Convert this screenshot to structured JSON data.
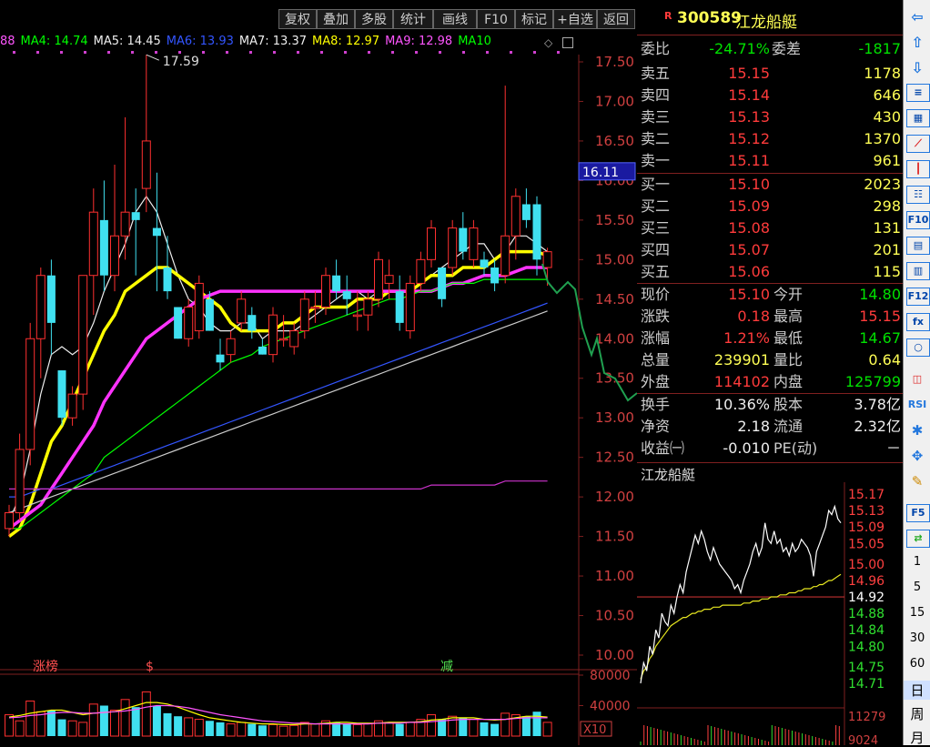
{
  "toolbar": {
    "buttons": [
      "复权",
      "叠加",
      "多股",
      "统计",
      "画线",
      "F10",
      "标记",
      "+自选",
      "返回"
    ]
  },
  "ma_bar": [
    {
      "label": "88",
      "color": "#ff55ff"
    },
    {
      "label": "MA4: 14.74",
      "color": "#00ff00"
    },
    {
      "label": "MA5: 14.45",
      "color": "#eeeeee"
    },
    {
      "label": "MA6: 13.93",
      "color": "#3355ff"
    },
    {
      "label": "MA7: 13.37",
      "color": "#eeeeee"
    },
    {
      "label": "MA8: 12.97",
      "color": "#ffff00"
    },
    {
      "label": "MA9: 12.98",
      "color": "#ff55ff"
    },
    {
      "label": "MA10",
      "color": "#00ff00"
    }
  ],
  "chart": {
    "high_label": "17.59",
    "price_tag": "16.11",
    "y_ticks": [
      "17.50",
      "17.00",
      "16.50",
      "16.00",
      "15.50",
      "15.00",
      "14.50",
      "14.00",
      "13.50",
      "13.00",
      "12.50",
      "12.00",
      "11.50",
      "11.00",
      "10.50",
      "10.00"
    ],
    "vol_ticks": [
      "80000",
      "40000"
    ],
    "vol_unit": "X10",
    "markers": [
      "涨榜",
      "$",
      "减"
    ]
  },
  "chart_data": {
    "type": "candlestick",
    "candles": [
      [
        11.6,
        11.9,
        11.5,
        11.8
      ],
      [
        11.8,
        12.8,
        11.7,
        12.6
      ],
      [
        12.6,
        14.2,
        12.4,
        14.0
      ],
      [
        14.0,
        14.9,
        13.5,
        14.8
      ],
      [
        14.8,
        15.0,
        13.8,
        14.2
      ],
      [
        13.6,
        13.6,
        12.9,
        13.0
      ],
      [
        13.0,
        13.4,
        12.9,
        13.3
      ],
      [
        13.3,
        14.8,
        13.1,
        14.8
      ],
      [
        14.8,
        15.9,
        14.3,
        15.6
      ],
      [
        15.5,
        16.0,
        14.6,
        14.8
      ],
      [
        14.8,
        16.2,
        14.6,
        15.3
      ],
      [
        15.3,
        16.8,
        15.0,
        15.6
      ],
      [
        15.6,
        15.9,
        14.8,
        15.5
      ],
      [
        15.9,
        17.59,
        15.6,
        16.5
      ],
      [
        15.4,
        16.1,
        14.6,
        15.3
      ],
      [
        14.9,
        15.3,
        14.5,
        14.6
      ],
      [
        14.4,
        14.4,
        14.0,
        14.0
      ],
      [
        14.0,
        14.5,
        13.9,
        14.4
      ],
      [
        14.1,
        14.8,
        14.0,
        14.7
      ],
      [
        14.5,
        14.6,
        14.1,
        14.1
      ],
      [
        13.8,
        14.0,
        13.6,
        13.7
      ],
      [
        13.8,
        14.1,
        13.7,
        14.0
      ],
      [
        14.2,
        14.6,
        14.1,
        14.5
      ],
      [
        14.3,
        14.4,
        14.0,
        14.1
      ],
      [
        13.9,
        14.0,
        13.8,
        13.8
      ],
      [
        13.8,
        14.4,
        13.7,
        14.3
      ],
      [
        14.0,
        14.3,
        13.9,
        14.0
      ],
      [
        13.9,
        14.2,
        13.8,
        14.1
      ],
      [
        14.1,
        14.6,
        14.0,
        14.5
      ],
      [
        14.4,
        14.6,
        14.2,
        14.4
      ],
      [
        14.4,
        14.9,
        14.3,
        14.8
      ],
      [
        14.8,
        15.0,
        14.5,
        14.6
      ],
      [
        14.6,
        14.8,
        14.3,
        14.5
      ],
      [
        14.3,
        14.6,
        14.1,
        14.3
      ],
      [
        14.3,
        14.6,
        14.1,
        14.5
      ],
      [
        14.5,
        15.1,
        14.4,
        15.0
      ],
      [
        14.7,
        15.0,
        14.5,
        14.8
      ],
      [
        14.6,
        14.8,
        14.1,
        14.2
      ],
      [
        14.1,
        14.8,
        14.0,
        14.7
      ],
      [
        14.7,
        15.1,
        14.6,
        15.0
      ],
      [
        15.0,
        15.5,
        14.9,
        15.4
      ],
      [
        14.9,
        14.9,
        14.4,
        14.5
      ],
      [
        14.9,
        15.5,
        14.8,
        15.4
      ],
      [
        15.4,
        15.6,
        15.0,
        15.1
      ],
      [
        15.0,
        15.5,
        14.9,
        15.4
      ],
      [
        15.0,
        15.1,
        14.8,
        14.9
      ],
      [
        14.9,
        15.0,
        14.6,
        14.7
      ],
      [
        14.8,
        17.2,
        14.7,
        15.3
      ],
      [
        15.3,
        15.9,
        15.0,
        15.8
      ],
      [
        15.7,
        15.9,
        15.4,
        15.5
      ],
      [
        15.7,
        15.8,
        14.8,
        15.0
      ],
      [
        14.9,
        15.15,
        14.67,
        15.1
      ]
    ],
    "volume": [
      28000,
      20000,
      46000,
      32000,
      34000,
      22000,
      20000,
      18000,
      42000,
      40000,
      34000,
      48000,
      38000,
      58000,
      40000,
      30000,
      26000,
      24000,
      22000,
      20000,
      18000,
      16000,
      18000,
      16000,
      14000,
      15000,
      13000,
      14000,
      18000,
      16000,
      20000,
      18000,
      16000,
      15000,
      16000,
      20000,
      18000,
      16000,
      18000,
      22000,
      28000,
      22000,
      26000,
      24000,
      22000,
      18000,
      16000,
      30000,
      28000,
      26000,
      32000,
      18000
    ],
    "vol_ylim": [
      0,
      80000
    ],
    "ylim": [
      10.0,
      17.59
    ],
    "ma_lines": [
      {
        "name": "MA5",
        "color": "#eeeeee",
        "width": 1.2,
        "values": [
          11.7,
          12.0,
          12.6,
          13.3,
          13.8,
          13.9,
          13.8,
          13.9,
          14.2,
          14.6,
          14.9,
          15.2,
          15.6,
          15.8,
          15.6,
          15.2,
          14.8,
          14.5,
          14.4,
          14.2,
          14.1,
          14.1,
          14.2,
          14.2,
          14.0,
          14.1,
          14.1,
          14.1,
          14.2,
          14.3,
          14.4,
          14.5,
          14.6,
          14.6,
          14.5,
          14.6,
          14.6,
          14.6,
          14.6,
          14.7,
          14.8,
          14.9,
          15.0,
          15.1,
          15.2,
          15.2,
          15.0,
          15.1,
          15.3,
          15.3,
          15.2,
          15.1
        ]
      },
      {
        "name": "MA10",
        "color": "#ffff00",
        "width": 3.5,
        "values": [
          11.5,
          11.6,
          11.9,
          12.3,
          12.7,
          12.9,
          13.2,
          13.5,
          13.8,
          14.1,
          14.3,
          14.6,
          14.7,
          14.8,
          14.9,
          14.9,
          14.8,
          14.7,
          14.6,
          14.5,
          14.4,
          14.2,
          14.1,
          14.1,
          14.1,
          14.1,
          14.2,
          14.2,
          14.3,
          14.4,
          14.4,
          14.4,
          14.4,
          14.5,
          14.5,
          14.5,
          14.6,
          14.6,
          14.6,
          14.7,
          14.8,
          14.8,
          14.8,
          14.9,
          14.9,
          14.9,
          15.0,
          15.1,
          15.1,
          15.1,
          15.1,
          15.05
        ]
      },
      {
        "name": "MA20",
        "color": "#ff33ff",
        "width": 3.5,
        "values": [
          11.6,
          11.7,
          11.8,
          11.9,
          12.1,
          12.3,
          12.5,
          12.7,
          12.9,
          13.2,
          13.4,
          13.6,
          13.8,
          14.0,
          14.1,
          14.2,
          14.3,
          14.4,
          14.5,
          14.55,
          14.6,
          14.6,
          14.6,
          14.6,
          14.6,
          14.6,
          14.6,
          14.6,
          14.6,
          14.6,
          14.6,
          14.6,
          14.6,
          14.6,
          14.6,
          14.6,
          14.6,
          14.6,
          14.6,
          14.6,
          14.6,
          14.65,
          14.7,
          14.7,
          14.75,
          14.8,
          14.8,
          14.8,
          14.85,
          14.9,
          14.9,
          14.9
        ]
      },
      {
        "name": "MA30",
        "color": "#00ff00",
        "width": 1.2,
        "values": [
          11.6,
          11.6,
          11.7,
          11.8,
          11.9,
          12.0,
          12.1,
          12.2,
          12.3,
          12.5,
          12.6,
          12.7,
          12.8,
          12.9,
          13.0,
          13.1,
          13.2,
          13.3,
          13.4,
          13.5,
          13.6,
          13.7,
          13.75,
          13.8,
          13.9,
          13.95,
          14.0,
          14.05,
          14.1,
          14.15,
          14.2,
          14.25,
          14.3,
          14.35,
          14.4,
          14.45,
          14.5,
          14.5,
          14.55,
          14.6,
          14.6,
          14.65,
          14.7,
          14.7,
          14.7,
          14.75,
          14.75,
          14.75,
          14.75,
          14.75,
          14.75,
          14.75
        ]
      },
      {
        "name": "MA60",
        "color": "#3355ff",
        "width": 1.2,
        "values": [
          12.0,
          12.0,
          12.05,
          12.1,
          12.1,
          12.15,
          12.2,
          12.25,
          12.3,
          12.35,
          12.4,
          12.45,
          12.5,
          12.55,
          12.6,
          12.65,
          12.7,
          12.75,
          12.8,
          12.85,
          12.9,
          12.95,
          13.0,
          13.05,
          13.1,
          13.15,
          13.2,
          13.25,
          13.3,
          13.35,
          13.4,
          13.45,
          13.5,
          13.55,
          13.6,
          13.65,
          13.7,
          13.75,
          13.8,
          13.85,
          13.9,
          13.95,
          14.0,
          14.05,
          14.1,
          14.15,
          14.2,
          14.25,
          14.3,
          14.35,
          14.4,
          14.45
        ]
      },
      {
        "name": "MA120",
        "color": "#cccccc",
        "width": 1.2,
        "values": [
          11.8,
          11.85,
          11.9,
          11.95,
          12.0,
          12.05,
          12.1,
          12.15,
          12.2,
          12.25,
          12.3,
          12.35,
          12.4,
          12.45,
          12.5,
          12.55,
          12.6,
          12.65,
          12.7,
          12.75,
          12.8,
          12.85,
          12.9,
          12.95,
          13.0,
          13.05,
          13.1,
          13.15,
          13.2,
          13.25,
          13.3,
          13.35,
          13.4,
          13.45,
          13.5,
          13.55,
          13.6,
          13.65,
          13.7,
          13.75,
          13.8,
          13.85,
          13.9,
          13.95,
          14.0,
          14.05,
          14.1,
          14.15,
          14.2,
          14.25,
          14.3,
          14.35
        ]
      },
      {
        "name": "MA250",
        "color": "#cc33cc",
        "width": 1.2,
        "values": [
          12.1,
          12.1,
          12.1,
          12.1,
          12.1,
          12.1,
          12.1,
          12.1,
          12.1,
          12.1,
          12.1,
          12.1,
          12.1,
          12.1,
          12.1,
          12.1,
          12.1,
          12.1,
          12.1,
          12.1,
          12.1,
          12.1,
          12.1,
          12.1,
          12.1,
          12.1,
          12.1,
          12.1,
          12.1,
          12.1,
          12.1,
          12.1,
          12.1,
          12.1,
          12.1,
          12.1,
          12.1,
          12.1,
          12.1,
          12.1,
          12.15,
          12.15,
          12.15,
          12.15,
          12.15,
          12.15,
          12.15,
          12.2,
          12.2,
          12.2,
          12.2,
          12.2
        ]
      }
    ],
    "vol_lines": [
      {
        "name": "VMA5",
        "color": "#ffff00",
        "values": [
          25000,
          27000,
          30000,
          32000,
          34000,
          34000,
          31000,
          28000,
          30000,
          31000,
          32000,
          36000,
          40000,
          44000,
          44000,
          42000,
          38000,
          33000,
          28000,
          24000,
          22000,
          20000,
          18000,
          17000,
          16000,
          16000,
          15000,
          15000,
          16000,
          16000,
          17000,
          18000,
          18000,
          17000,
          17000,
          17000,
          18000,
          18000,
          18000,
          19000,
          21000,
          22000,
          24000,
          24000,
          24000,
          22000,
          21000,
          22000,
          24000,
          26000,
          26000,
          25000
        ]
      },
      {
        "name": "VMA10",
        "color": "#ff55ff",
        "values": [
          24000,
          25000,
          27000,
          28000,
          30000,
          31000,
          31000,
          30000,
          30000,
          31000,
          32000,
          33000,
          35000,
          38000,
          40000,
          40000,
          39000,
          37000,
          34000,
          31000,
          28000,
          26000,
          24000,
          22000,
          20000,
          19000,
          18000,
          17000,
          17000,
          16000,
          16000,
          16000,
          16000,
          16000,
          16000,
          17000,
          17000,
          17000,
          18000,
          18000,
          19000,
          20000,
          21000,
          22000,
          22000,
          22000,
          22000,
          22000,
          23000,
          24000,
          24000,
          24000
        ]
      }
    ]
  },
  "quote": {
    "code": "300589",
    "name": "江龙船艇",
    "weibi_label": "委比",
    "weibi": "-24.71%",
    "weicha_label": "委差",
    "weicha": "-1817",
    "sells": [
      {
        "label": "卖五",
        "price": "15.15",
        "vol": "1178"
      },
      {
        "label": "卖四",
        "price": "15.14",
        "vol": "646"
      },
      {
        "label": "卖三",
        "price": "15.13",
        "vol": "430"
      },
      {
        "label": "卖二",
        "price": "15.12",
        "vol": "1370"
      },
      {
        "label": "卖一",
        "price": "15.11",
        "vol": "961"
      }
    ],
    "buys": [
      {
        "label": "买一",
        "price": "15.10",
        "vol": "2023"
      },
      {
        "label": "买二",
        "price": "15.09",
        "vol": "298"
      },
      {
        "label": "买三",
        "price": "15.08",
        "vol": "131"
      },
      {
        "label": "买四",
        "price": "15.07",
        "vol": "201"
      },
      {
        "label": "买五",
        "price": "15.06",
        "vol": "115"
      }
    ],
    "stats": [
      {
        "l1": "现价",
        "v1": "15.10",
        "c1": "red",
        "l2": "今开",
        "v2": "14.80",
        "c2": "green"
      },
      {
        "l1": "涨跌",
        "v1": "0.18",
        "c1": "red",
        "l2": "最高",
        "v2": "15.15",
        "c2": "red"
      },
      {
        "l1": "涨幅",
        "v1": "1.21%",
        "c1": "red",
        "l2": "最低",
        "v2": "14.67",
        "c2": "green"
      },
      {
        "l1": "总量",
        "v1": "239901",
        "c1": "yellow",
        "l2": "量比",
        "v2": "0.64",
        "c2": "yellow"
      },
      {
        "l1": "外盘",
        "v1": "114102",
        "c1": "red",
        "l2": "内盘",
        "v2": "125799",
        "c2": "green"
      }
    ],
    "fin": [
      {
        "l1": "换手",
        "v1": "10.36%",
        "l2": "股本",
        "v2": "3.78亿"
      },
      {
        "l1": "净资",
        "v1": "2.18",
        "l2": "流通",
        "v2": "2.32亿"
      },
      {
        "l1": "收益㈠",
        "v1": "-0.010",
        "l2": "PE(动)",
        "v2": "－"
      }
    ]
  },
  "intraday": {
    "title": "江龙船艇",
    "ticks_top": [
      "15.17",
      "15.13",
      "15.09",
      "15.05",
      "15.00",
      "14.96"
    ],
    "prev_close": "14.92",
    "ticks_bottom": [
      "14.88",
      "14.84",
      "14.80",
      "14.75",
      "14.71"
    ],
    "vol_ticks": [
      "11279",
      "9024"
    ]
  },
  "chart_data_intraday": {
    "type": "line",
    "ylim": [
      14.69,
      15.19
    ],
    "price": [
      14.71,
      14.76,
      14.74,
      14.8,
      14.78,
      14.84,
      14.82,
      14.88,
      14.86,
      14.85,
      14.9,
      14.88,
      14.92,
      14.95,
      14.93,
      14.98,
      15.01,
      15.04,
      15.07,
      15.05,
      15.08,
      15.06,
      15.03,
      15.01,
      15.04,
      15.02,
      15.0,
      14.99,
      14.98,
      14.97,
      14.96,
      14.94,
      14.95,
      14.93,
      14.96,
      14.98,
      15.0,
      15.03,
      15.05,
      15.02,
      15.04,
      15.1,
      15.06,
      15.05,
      15.08,
      15.05,
      15.06,
      15.03,
      15.04,
      15.02,
      15.05,
      15.03,
      15.04,
      15.06,
      15.05,
      15.04,
      15.02,
      14.97,
      15.03,
      15.05,
      15.07,
      15.09,
      15.13,
      15.12,
      15.14,
      15.11,
      15.1
    ],
    "avg": [
      14.72,
      14.74,
      14.75,
      14.77,
      14.78,
      14.8,
      14.81,
      14.82,
      14.83,
      14.84,
      14.85,
      14.855,
      14.86,
      14.865,
      14.87,
      14.87,
      14.875,
      14.88,
      14.88,
      14.885,
      14.885,
      14.89,
      14.89,
      14.89,
      14.895,
      14.895,
      14.895,
      14.9,
      14.9,
      14.9,
      14.9,
      14.9,
      14.9,
      14.9,
      14.905,
      14.905,
      14.905,
      14.91,
      14.91,
      14.91,
      14.915,
      14.915,
      14.915,
      14.92,
      14.92,
      14.92,
      14.925,
      14.925,
      14.925,
      14.93,
      14.93,
      14.93,
      14.935,
      14.935,
      14.94,
      14.94,
      14.94,
      14.945,
      14.945,
      14.95,
      14.95,
      14.955,
      14.96,
      14.96,
      14.965,
      14.97,
      14.975
    ]
  },
  "sidebar": {
    "numbers": [
      "1",
      "5",
      "15",
      "30",
      "60"
    ],
    "periods": [
      "日",
      "周",
      "月"
    ]
  }
}
